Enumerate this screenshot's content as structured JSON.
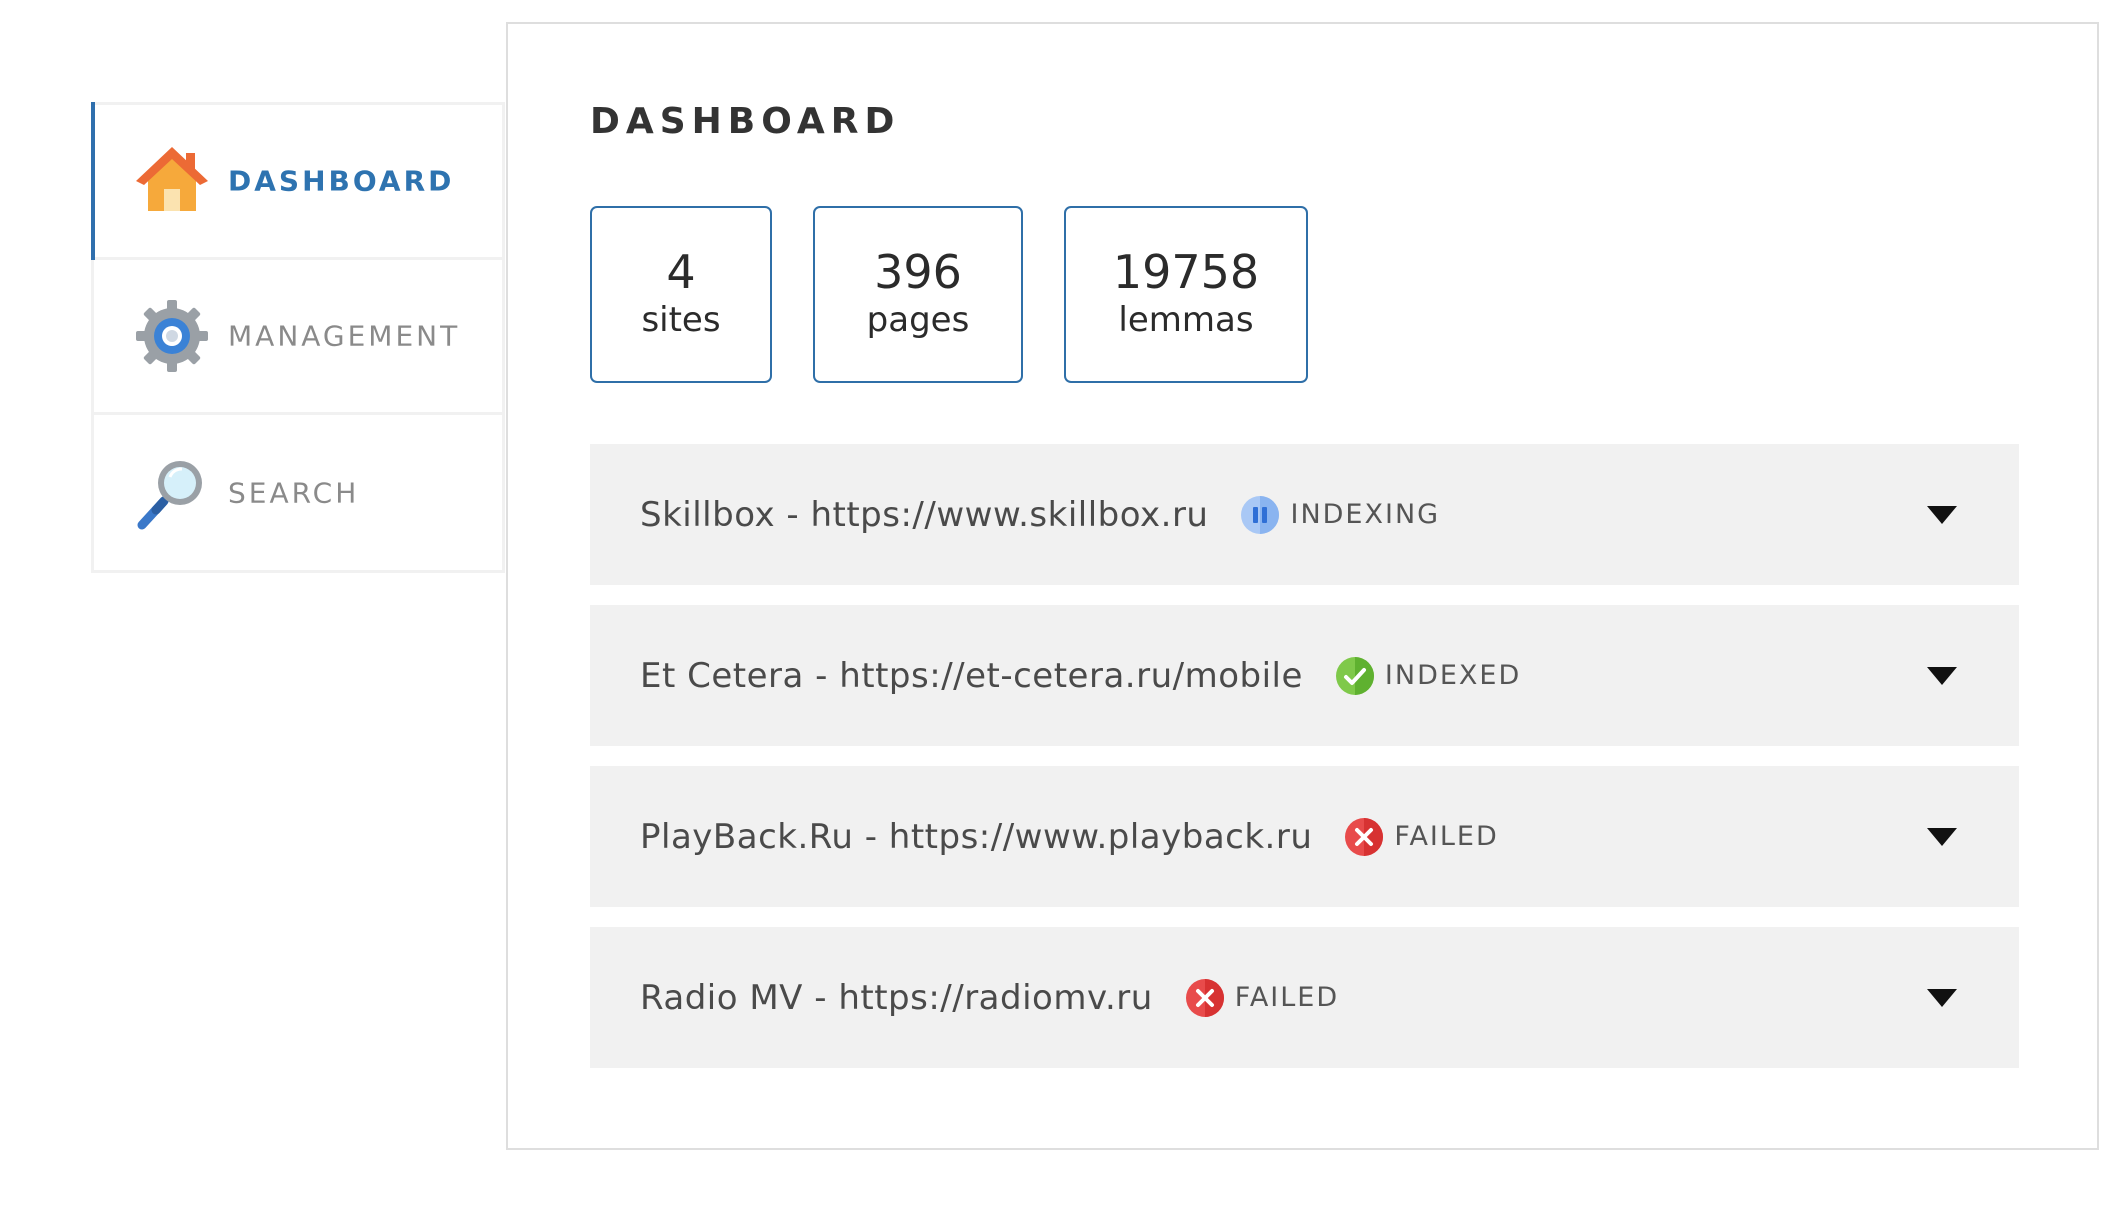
{
  "sidebar": {
    "items": [
      {
        "label": "DASHBOARD",
        "icon": "home-icon",
        "active": true
      },
      {
        "label": "MANAGEMENT",
        "icon": "gear-icon",
        "active": false
      },
      {
        "label": "SEARCH",
        "icon": "magnifier-icon",
        "active": false
      }
    ]
  },
  "main": {
    "title": "DASHBOARD",
    "stats": [
      {
        "value": "4",
        "label": "sites"
      },
      {
        "value": "396",
        "label": "pages"
      },
      {
        "value": "19758",
        "label": "lemmas"
      }
    ],
    "sites": [
      {
        "title": "Skillbox - https://www.skillbox.ru",
        "status": "INDEXING",
        "status_icon": "pause-icon"
      },
      {
        "title": "Et Cetera - https://et-cetera.ru/mobile",
        "status": "INDEXED",
        "status_icon": "check-icon"
      },
      {
        "title": "PlayBack.Ru - https://www.playback.ru",
        "status": "FAILED",
        "status_icon": "error-icon"
      },
      {
        "title": "Radio MV - https://radiomv.ru",
        "status": "FAILED",
        "status_icon": "error-icon"
      }
    ]
  },
  "colors": {
    "accent": "#2e73b0",
    "card_border": "#2f6fa8",
    "row_background": "#f1f1f1",
    "indexing": "#8ab4f0",
    "indexed": "#6cbf3c",
    "failed": "#e23b3b"
  }
}
